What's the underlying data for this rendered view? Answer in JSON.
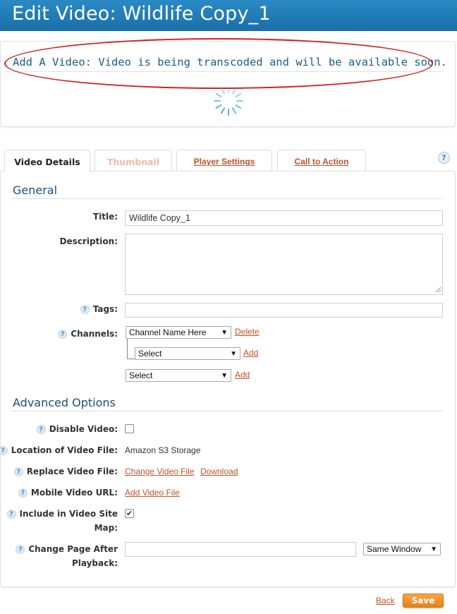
{
  "header": {
    "title": "Edit Video: Wildlife Copy_1"
  },
  "notice": {
    "text": "Add A Video: Video is being transcoded and will be available soon."
  },
  "tabs": [
    {
      "label": "Video Details",
      "state": "active"
    },
    {
      "label": "Thumbnail",
      "state": "disabled"
    },
    {
      "label": "Player Settings",
      "state": "link"
    },
    {
      "label": "Call to Action",
      "state": "link"
    }
  ],
  "help_icon": "?",
  "general": {
    "title": "General",
    "title_label": "Title:",
    "title_value": "Wildlife Copy_1",
    "description_label": "Description:",
    "description_value": "",
    "tags_label": "Tags:",
    "tags_value": "",
    "channels_label": "Channels:",
    "channel_select_1": "Channel Name Here",
    "channel_delete": "Delete",
    "channel_sub_select": "Select",
    "channel_sub_add": "Add",
    "channel_select_2": "Select",
    "channel_add_2": "Add"
  },
  "advanced": {
    "title": "Advanced Options",
    "disable_label": "Disable Video:",
    "disable_checked": false,
    "location_label": "Location of Video File:",
    "location_value": "Amazon S3 Storage",
    "replace_label": "Replace Video File:",
    "replace_change": "Change Video File",
    "replace_download": "Download",
    "mobile_label": "Mobile Video URL:",
    "mobile_add": "Add Video File",
    "sitemap_label_1": "Include in Video Site",
    "sitemap_label_2": "Map:",
    "sitemap_checked": true,
    "change_page_label_1": "Change Page After",
    "change_page_label_2": "Playback:",
    "change_page_value": "",
    "window_select": "Same Window"
  },
  "footer": {
    "back": "Back",
    "save": "Save"
  },
  "colors": {
    "header": "#1f7bb6",
    "accent_link": "#c2522a",
    "save": "#f39a2e",
    "annotation": "#d42020"
  }
}
